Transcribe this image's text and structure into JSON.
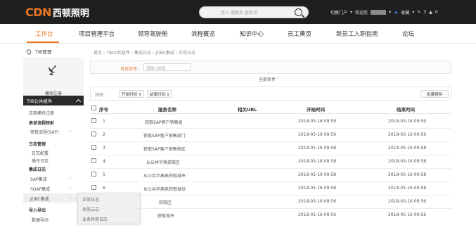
{
  "header": {
    "logo_letters": "CDN",
    "logo_text": "西顿照明",
    "search_placeholder": "姓入 搜职员 查会议",
    "portal": "切换门户",
    "welcome": "欢迎您",
    "favorites": "收藏",
    "edit_count": "3",
    "alert_count": "0"
  },
  "nav": {
    "items": [
      "工作台",
      "项目管理平台",
      "领导驾驶舱",
      "流程概览",
      "知识中心",
      "员工黄页",
      "新员工入职指南",
      "论坛"
    ]
  },
  "sidebar": {
    "title": "TIB管理",
    "tile_label": "模块注册",
    "group": "TIB公共组件",
    "rows": [
      "应用模块注册",
      "表单流程映射",
      "审批流程(SAP)",
      "日志管理",
      "日志配置",
      "操作日志",
      "集成日志",
      "SAP集成",
      "SOAP集成",
      "JDBC集成",
      "导入导出",
      "数据导出"
    ],
    "popup": [
      "正常日志",
      "异常日志",
      "业务异常日志"
    ]
  },
  "main": {
    "breadcrumb": "首页 › TIB公共组件 › 集成日志 › JDBC集成 › 正常日志",
    "filter_label": "日志条件:",
    "filter_placeholder": "请输入标题",
    "all_conditions": "全部条件 ˅",
    "sort_label": "排序:",
    "sort_start": "开始时间 ⇕",
    "sort_end": "结束时间 ⇕",
    "batch_delete": "批量删除",
    "columns": [
      "序号",
      "服务名称",
      "相关URL",
      "开始时间",
      "结束时间"
    ],
    "rows": [
      {
        "no": "1",
        "name": "获取SAP客户销售组",
        "url": "",
        "start": "2018-05-16 09:59",
        "end": "2018-05-16 09:59"
      },
      {
        "no": "2",
        "name": "获取SAP客户销售部门",
        "url": "",
        "start": "2018-05-16 09:59",
        "end": "2018-05-16 09:59"
      },
      {
        "no": "3",
        "name": "获取SAP客户销售地区",
        "url": "",
        "start": "2018-05-16 09:58",
        "end": "2018-05-16 09:58"
      },
      {
        "no": "4",
        "name": "从公共字典获取区",
        "url": "",
        "start": "2018-05-16 09:58",
        "end": "2018-05-16 09:58"
      },
      {
        "no": "5",
        "name": "从公共字典表获取城市",
        "url": "",
        "start": "2018-05-16 09:58",
        "end": "2018-05-16 09:58"
      },
      {
        "no": "6",
        "name": "从公共字典表获取省份",
        "url": "",
        "start": "2018-05-16 09:58",
        "end": "2018-05-16 09:58"
      },
      {
        "no": "",
        "name": "获取区",
        "url": "",
        "start": "2018-05-16 09:56",
        "end": "2018-05-16 09:56"
      },
      {
        "no": "",
        "name": "获取城市",
        "url": "",
        "start": "2018-05-16 09:56",
        "end": "2018-05-16 09:56"
      }
    ]
  }
}
